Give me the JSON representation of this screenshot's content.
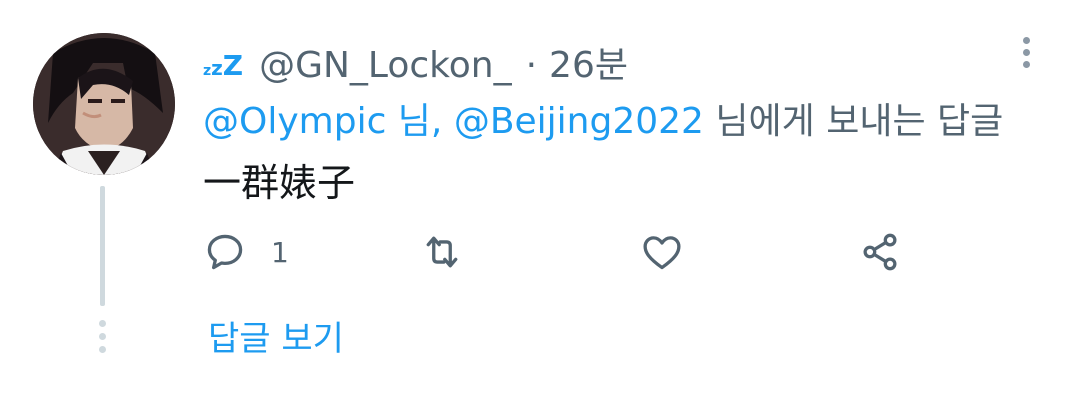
{
  "tweet": {
    "status_icon": "sleep-zzz-icon",
    "status_text": "zzZ",
    "handle": "@GN_Lockon_",
    "separator": "·",
    "time": "26분",
    "reply_to": {
      "mention1": "@Olympic",
      "joiner": " 님, ",
      "mention2": "@Beijing2022",
      "suffix": " 님에게 보내는 답글"
    },
    "text": "一群婊子",
    "actions": {
      "reply_icon": "reply-icon",
      "reply_count": "1",
      "retweet_icon": "retweet-icon",
      "like_icon": "heart-icon",
      "share_icon": "share-icon"
    },
    "show_replies_label": "답글 보기"
  },
  "colors": {
    "accent": "#1d9bf0",
    "secondary_text": "#536471",
    "thread_line": "#cfd9de"
  }
}
